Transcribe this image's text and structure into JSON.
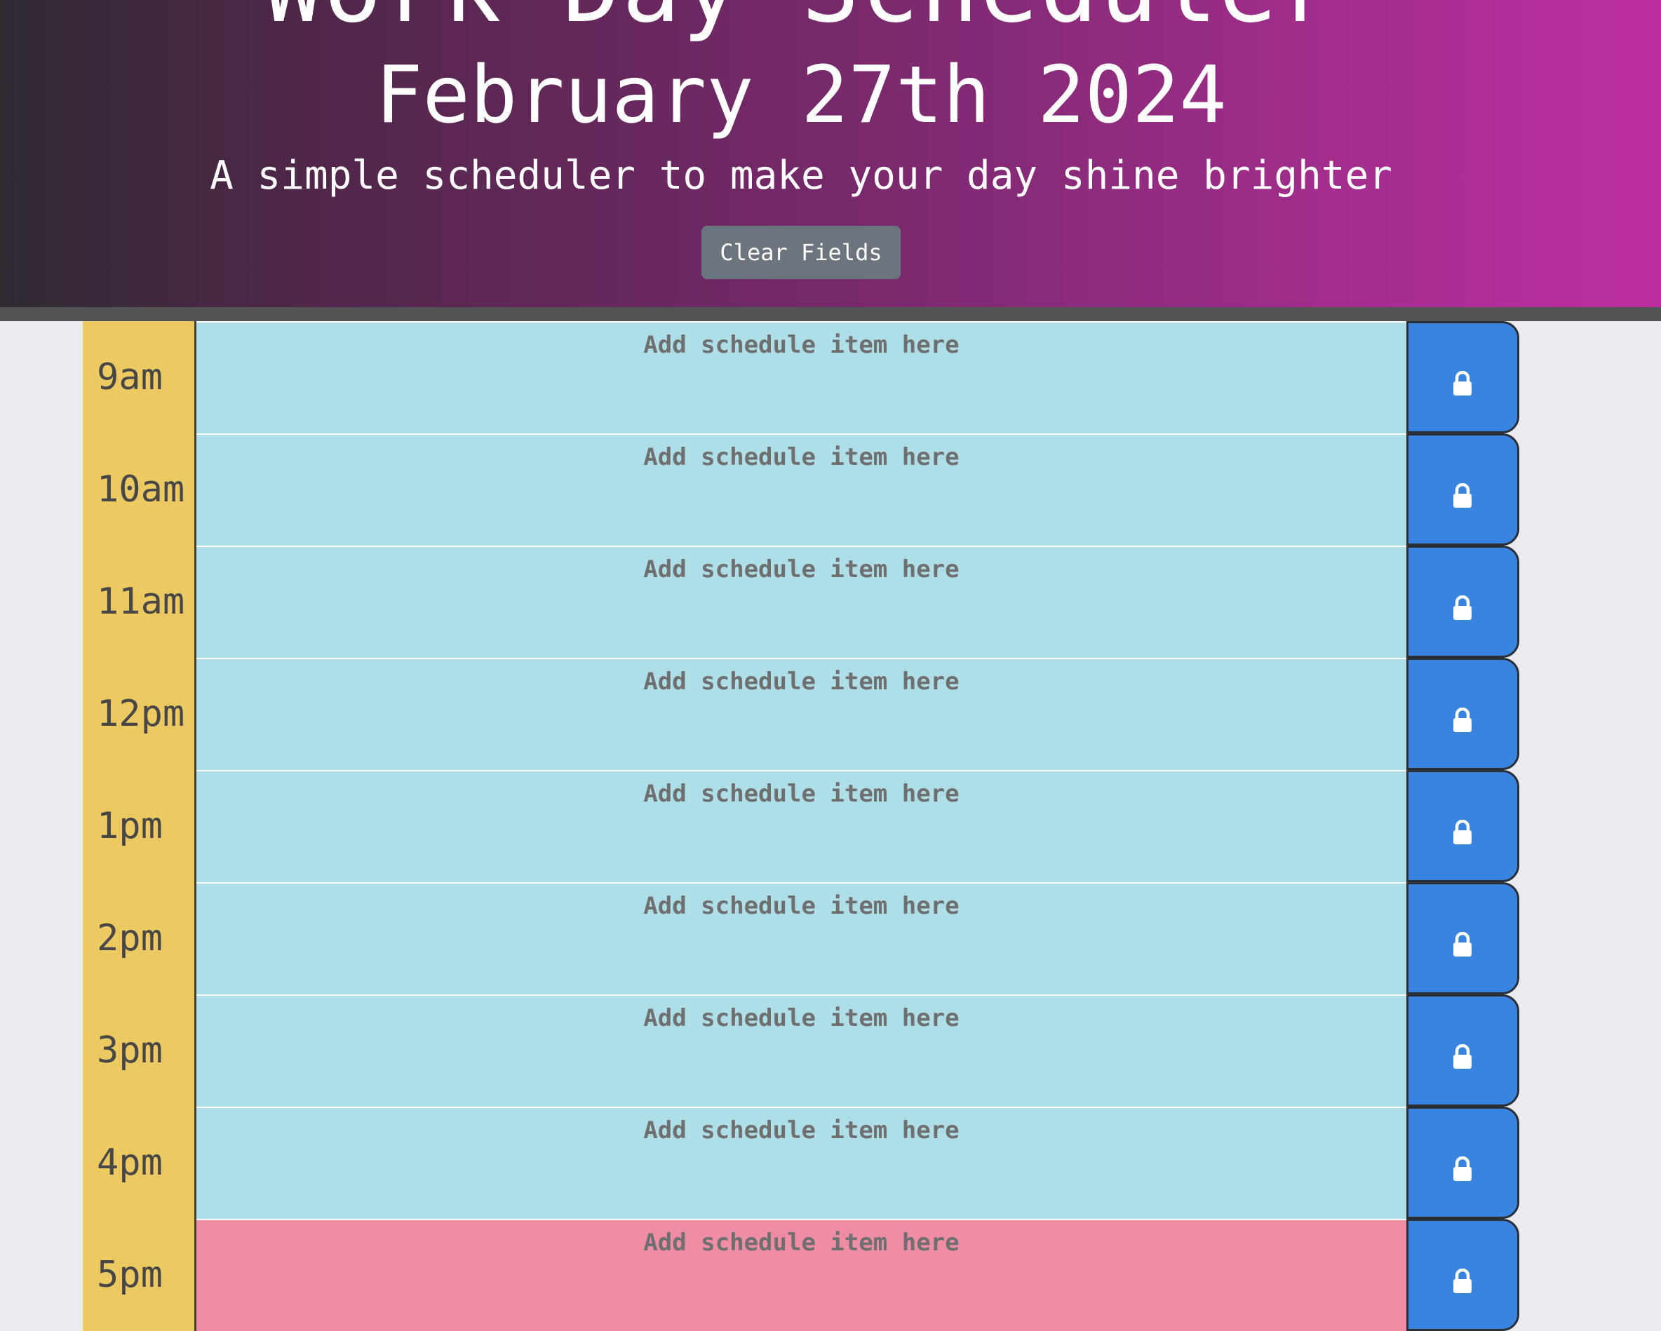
{
  "header": {
    "title": "Work Day Scheduler",
    "date": "February 27th 2024",
    "subtitle": "A simple scheduler to make your day shine brighter",
    "clear_label": "Clear Fields"
  },
  "schedule": {
    "placeholder": "Add schedule item here",
    "save_icon": "lock-icon",
    "colors": {
      "hour_bg": "#ecca61",
      "future": "#aedfe8",
      "present": "#ef8da5",
      "save": "#3884de"
    },
    "rows": [
      {
        "hour": "9am",
        "status": "future",
        "text": ""
      },
      {
        "hour": "10am",
        "status": "future",
        "text": ""
      },
      {
        "hour": "11am",
        "status": "future",
        "text": ""
      },
      {
        "hour": "12pm",
        "status": "future",
        "text": ""
      },
      {
        "hour": "1pm",
        "status": "future",
        "text": ""
      },
      {
        "hour": "2pm",
        "status": "future",
        "text": ""
      },
      {
        "hour": "3pm",
        "status": "future",
        "text": ""
      },
      {
        "hour": "4pm",
        "status": "future",
        "text": ""
      },
      {
        "hour": "5pm",
        "status": "present",
        "text": ""
      }
    ]
  }
}
